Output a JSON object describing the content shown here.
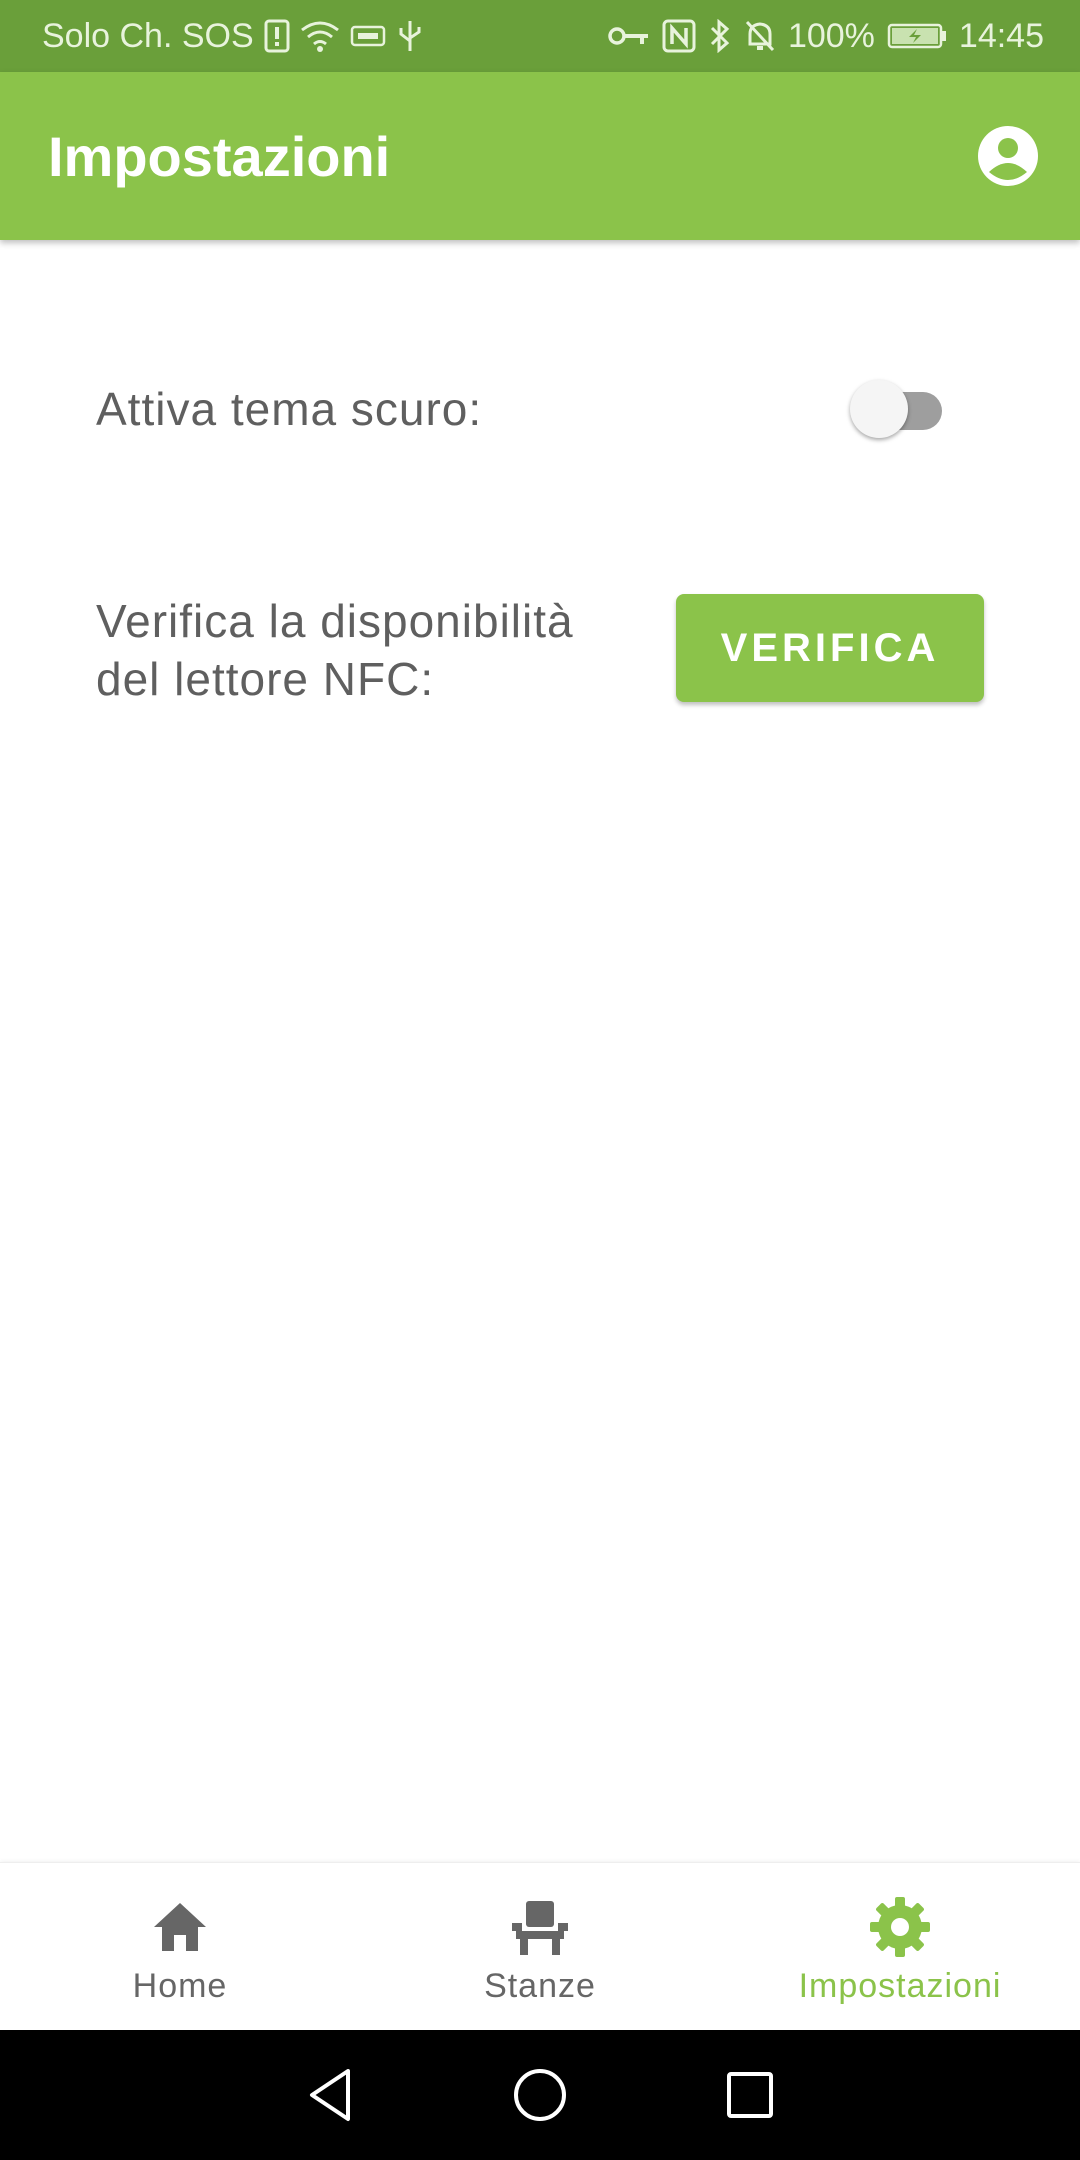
{
  "status_bar": {
    "carrier": "Solo Ch. SOS",
    "battery": "100%",
    "time": "14:45",
    "icons": [
      "sim-alert-icon",
      "wifi-icon",
      "vpn-card-icon",
      "usb-icon",
      "key-icon",
      "nfc-icon",
      "bluetooth-icon",
      "mute-bell-icon",
      "battery-icon"
    ]
  },
  "app_bar": {
    "title": "Impostazioni",
    "account_icon": "account-circle-icon"
  },
  "settings": {
    "dark_theme_label": "Attiva tema scuro:",
    "dark_theme_on": false,
    "nfc_label_line1": "Verifica la disponibilità",
    "nfc_label_line2": "del lettore NFC:",
    "verify_button": "VERIFICA"
  },
  "bottom_nav": {
    "items": [
      {
        "label": "Home",
        "icon": "home-icon",
        "active": false
      },
      {
        "label": "Stanze",
        "icon": "chair-icon",
        "active": false
      },
      {
        "label": "Impostazioni",
        "icon": "gear-icon",
        "active": true
      }
    ]
  },
  "colors": {
    "primary": "#8bc34a",
    "status_bar": "#6a9f3a",
    "text": "#5f5f5f",
    "inactive_nav": "#666666"
  }
}
